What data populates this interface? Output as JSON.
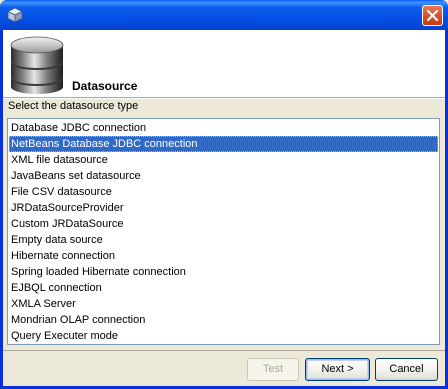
{
  "window": {
    "title": "",
    "close_icon": "close-icon"
  },
  "header": {
    "title": "Datasource",
    "icon": "database-icon"
  },
  "prompt": "Select the datasource type",
  "datasource_types": [
    "Database JDBC connection",
    "NetBeans Database JDBC connection",
    "XML file datasource",
    "JavaBeans set datasource",
    "File CSV datasource",
    "JRDataSourceProvider",
    "Custom JRDataSource",
    "Empty data source",
    "Hibernate connection",
    "Spring loaded Hibernate connection",
    "EJBQL connection",
    "XMLA Server",
    "Mondrian OLAP connection",
    "Query Executer mode"
  ],
  "selected_index": 1,
  "buttons": {
    "test": "Test",
    "next": "Next >",
    "cancel": "Cancel"
  },
  "colors": {
    "selection": "#316ac5",
    "titlebar": "#0550e6"
  }
}
